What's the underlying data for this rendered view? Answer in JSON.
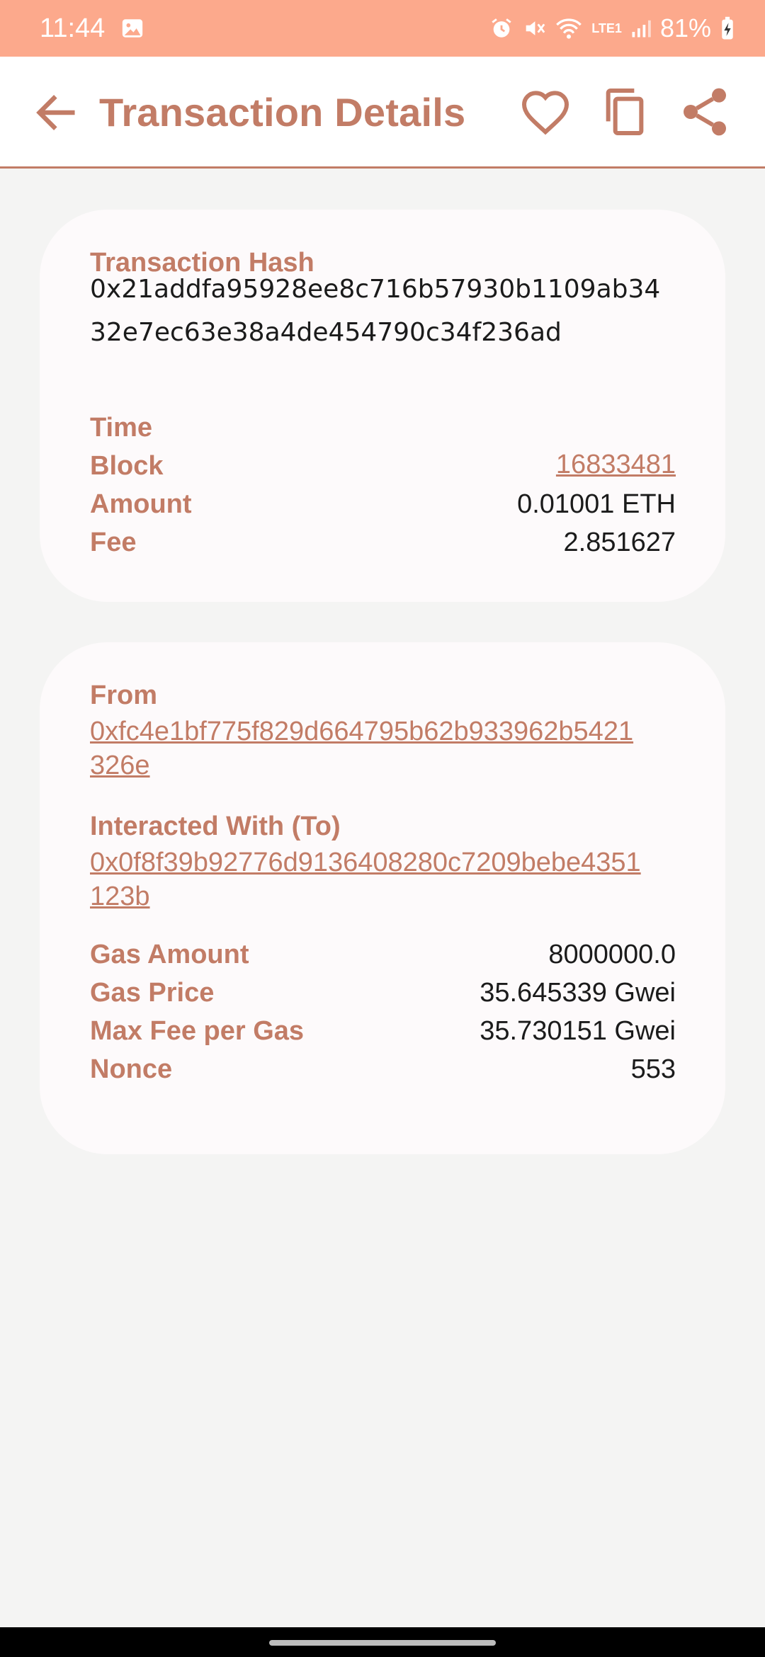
{
  "status_bar": {
    "time": "11:44",
    "battery": "81%",
    "network": "LTE1"
  },
  "app_bar": {
    "title": "Transaction Details",
    "icons": [
      "arrow-back-icon",
      "heart-icon",
      "copy-icon",
      "share-icon"
    ]
  },
  "summary": {
    "hash_label": "Transaction Hash",
    "hash_line1": "0x21addfa95928ee8c716b57930b1109ab34",
    "hash_line2": "32e7ec63e38a4de454790c34f236ad",
    "time_label": "Time",
    "block_label": "Block",
    "block_value": "16833481",
    "amount_label": "Amount",
    "amount_value": "0.01001 ETH",
    "fee_label": "Fee",
    "fee_value": "2.851627"
  },
  "details": {
    "from_label": "From",
    "from_line1": "0xfc4e1bf775f829d664795b62b933962b5421",
    "from_line2": "326e",
    "to_label": "Interacted With (To)",
    "to_line1": "0x0f8f39b92776d9136408280c7209bebe4351",
    "to_line2": "123b",
    "gas_amount_label": "Gas Amount",
    "gas_amount_value": "8000000.0",
    "gas_price_label": "Gas Price",
    "gas_price_value": "35.645339 Gwei",
    "max_fee_label": "Max Fee per Gas",
    "max_fee_value": "35.730151 Gwei",
    "nonce_label": "Nonce",
    "nonce_value": "553"
  },
  "colors": {
    "accent": "#c27c66",
    "status_bar": "#fca98c",
    "background": "#f4f4f3",
    "card": "#fdfafb"
  }
}
